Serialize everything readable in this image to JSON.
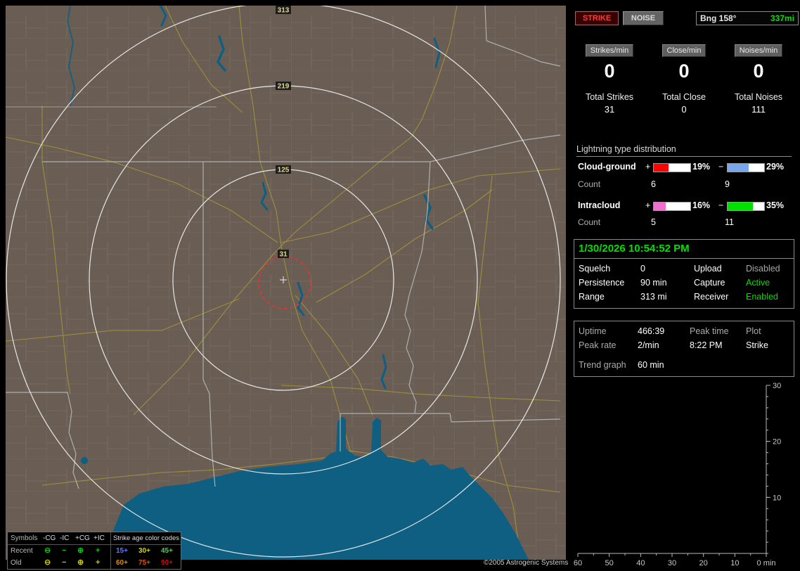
{
  "window": {
    "copyright": "©2005 Astrogenic Systems"
  },
  "map": {
    "ring_labels": [
      "313",
      "219",
      "125",
      "31"
    ],
    "legend": {
      "symbols_header": "Symbols",
      "col_headers": [
        "-CG",
        "-IC",
        "+CG",
        "+IC"
      ],
      "age_header": "Strike age color codes",
      "symbol_colors": {
        "recent": "#00c800",
        "old": "#c8c800"
      },
      "rows": [
        {
          "label": "Recent",
          "ages": [
            {
              "text": "15+",
              "color": "#5a7cff"
            },
            {
              "text": "30+",
              "color": "#d6d600"
            },
            {
              "text": "45+",
              "color": "#55cc55"
            }
          ]
        },
        {
          "label": "Old",
          "ages": [
            {
              "text": "60+",
              "color": "#e09000"
            },
            {
              "text": "75+",
              "color": "#e05500"
            },
            {
              "text": "90+",
              "color": "#e00000"
            }
          ]
        }
      ]
    }
  },
  "panel": {
    "strike_button": "STRIKE",
    "noise_button": "NOISE",
    "bearing_label": "Bng 158°",
    "bearing_distance": "337mi",
    "rate_boxes": [
      {
        "label": "Strikes/min",
        "value": "0"
      },
      {
        "label": "Close/min",
        "value": "0"
      },
      {
        "label": "Noises/min",
        "value": "0"
      }
    ],
    "totals": [
      {
        "label": "Total Strikes",
        "value": "31"
      },
      {
        "label": "Total Close",
        "value": "0"
      },
      {
        "label": "Total Noises",
        "value": "111"
      }
    ],
    "distribution": {
      "title": "Lightning type distribution",
      "rows": [
        {
          "label": "Cloud-ground",
          "pos": {
            "pct": "19%",
            "fill": 40,
            "color": "#ff0000"
          },
          "neg": {
            "pct": "29%",
            "fill": 58,
            "color": "#79a7ef"
          },
          "count_label": "Count",
          "pos_count": "6",
          "neg_count": "9"
        },
        {
          "label": "Intracloud",
          "pos": {
            "pct": "16%",
            "fill": 33,
            "color": "#ef6fd0"
          },
          "neg": {
            "pct": "35%",
            "fill": 70,
            "color": "#00e000"
          },
          "count_label": "Count",
          "pos_count": "5",
          "neg_count": "11"
        }
      ]
    },
    "datetime": "1/30/2026 10:54:52 PM",
    "settings": [
      {
        "label": "Squelch",
        "value": "0",
        "label2": "Upload",
        "value2": "Disabled",
        "value2_color": "#a8a8a8"
      },
      {
        "label": "Persistence",
        "value": "90 min",
        "label2": "Capture",
        "value2": "Active",
        "value2_color": "#00dd00"
      },
      {
        "label": "Range",
        "value": "313 mi",
        "label2": "Receiver",
        "value2": "Enabled",
        "value2_color": "#00dd00"
      }
    ],
    "status": {
      "uptime_label": "Uptime",
      "uptime": "466:39",
      "peak_time_label": "Peak time",
      "plot_label": "Plot",
      "peak_rate_label": "Peak rate",
      "peak_rate": "2/min",
      "peak_time": "8:22 PM",
      "plot": "Strike",
      "trend_label": "Trend graph",
      "trend_value": "60 min"
    }
  },
  "chart_data": {
    "type": "line",
    "title": "Strike trend graph (no data plotted)",
    "x_ticks": [
      "60",
      "50",
      "40",
      "30",
      "20",
      "10",
      "0 min"
    ],
    "y_ticks": [
      "30",
      "20",
      "10"
    ],
    "xlim": [
      60,
      0
    ],
    "ylim": [
      0,
      30
    ],
    "series": []
  }
}
